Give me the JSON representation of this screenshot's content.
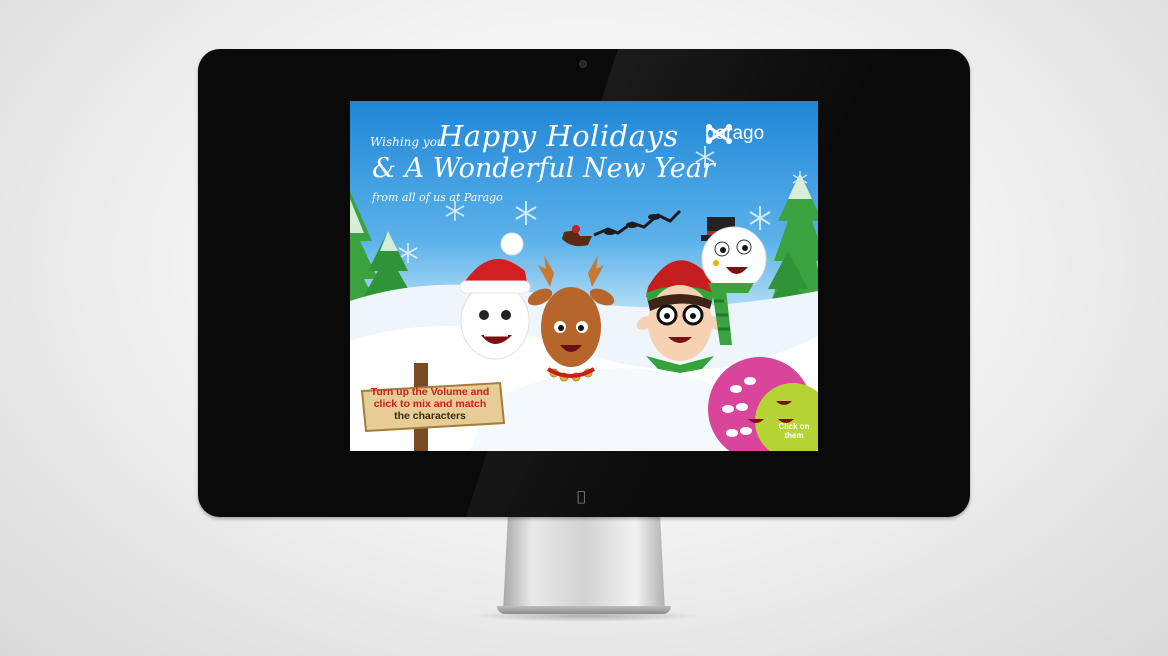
{
  "card": {
    "greeting_prefix": "Wishing you",
    "greeting_main": "Happy Holidays",
    "greeting_line2": "& A Wonderful New Year",
    "signoff": "from all of us at Parago",
    "brand_name": "parago",
    "sign_line1": "Turn up the Volume and",
    "sign_line2": "click to mix and match",
    "sign_line3": "the characters",
    "bubble_label": "Click on them"
  },
  "characters": [
    "santa",
    "reindeer",
    "elf",
    "snowman"
  ],
  "colors": {
    "sky_top": "#1f86d6",
    "snow": "#ffffff",
    "tree_green": "#3aa33f",
    "sign_red": "#d11b1b",
    "bubble_pink": "#d9459b",
    "bubble_lime": "#b5d334",
    "monitor_bezel": "#0a0a0a"
  },
  "icons": [
    "apple-logo-icon",
    "parago-logo-icon",
    "webcam-icon"
  ]
}
